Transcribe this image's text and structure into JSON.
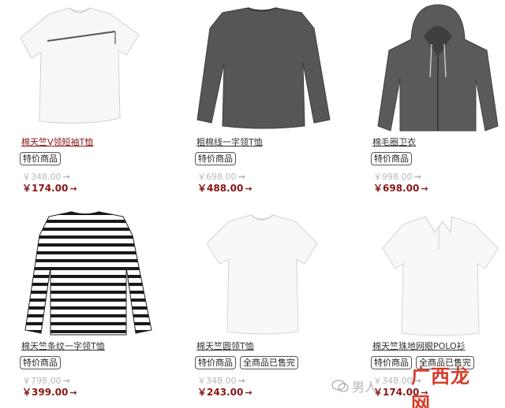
{
  "products": [
    {
      "title": "棉天竺V领短袖T恤",
      "badges": [
        "特价商品"
      ],
      "old_price": "￥348.00",
      "new_price": "￥174.00",
      "arrow": "→",
      "title_color": "#8a1515",
      "image_icon": "white-tshirt-image"
    },
    {
      "title": "粗棉线一字领T恤",
      "badges": [
        "特价商品"
      ],
      "old_price": "￥698.00",
      "new_price": "￥488.00",
      "arrow": "→",
      "title_color": "#222222",
      "image_icon": "gray-longsleeve-image"
    },
    {
      "title": "棉毛圈卫衣",
      "badges": [
        "特价商品"
      ],
      "old_price": "￥998.00",
      "new_price": "￥698.00",
      "arrow": "→",
      "title_color": "#222222",
      "image_icon": "gray-hoodie-image"
    },
    {
      "title": "棉天竺条纹一字领T恤",
      "badges": [
        "特价商品"
      ],
      "old_price": "￥798.00",
      "new_price": "￥399.00",
      "arrow": "→",
      "title_color": "#222222",
      "image_icon": "striped-longsleeve-image"
    },
    {
      "title": "棉天竺圆领T恤",
      "badges": [
        "特价商品",
        "全商品已售完"
      ],
      "old_price": "￥348.00",
      "new_price": "￥243.00",
      "arrow": "→",
      "title_color": "#222222",
      "image_icon": "white-crew-tshirt-image"
    },
    {
      "title": "棉天竺珠地网眼POLO衫",
      "badges": [
        "特价商品",
        "全商品已售完"
      ],
      "old_price": "￥348.00",
      "new_price": "￥174.00",
      "arrow": "→",
      "title_color": "#222222",
      "image_icon": "white-polo-image"
    }
  ],
  "watermark": {
    "text": "男人 ",
    "logo": "广西龙网"
  },
  "colors": {
    "sale_price": "#8a1515",
    "old_price": "#b8b8b8"
  }
}
